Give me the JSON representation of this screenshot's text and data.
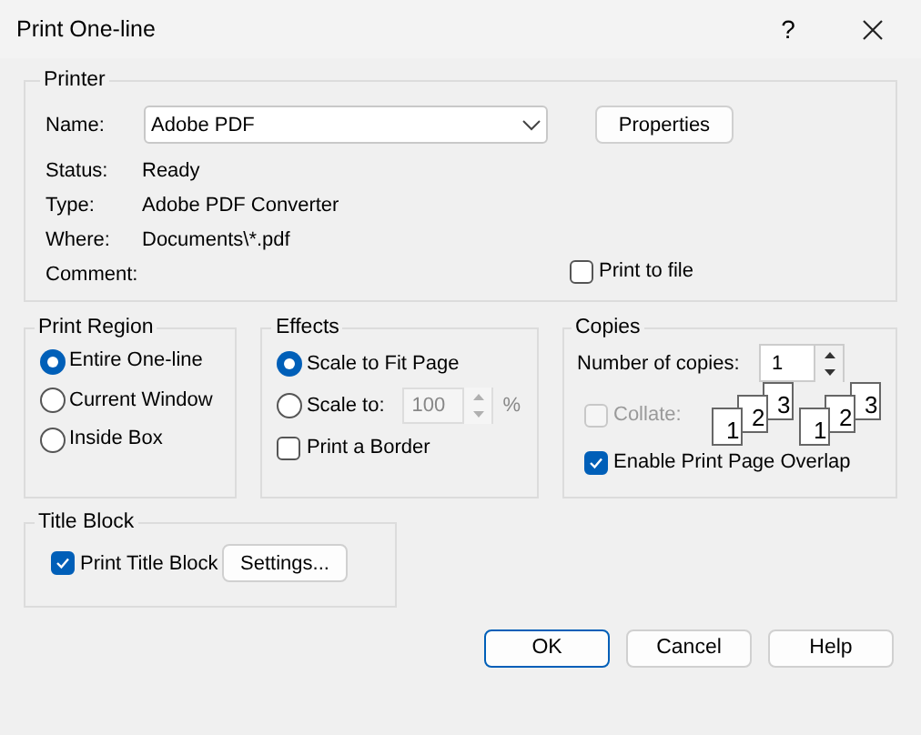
{
  "window": {
    "title": "Print One-line",
    "help_glyph": "?"
  },
  "printer": {
    "title": "Printer",
    "name_label": "Name:",
    "name_value": "Adobe PDF",
    "properties_button": "Properties",
    "info": [
      {
        "label": "Status:",
        "value": "Ready"
      },
      {
        "label": "Type:",
        "value": "Adobe PDF Converter"
      },
      {
        "label": "Where:",
        "value": "Documents\\*.pdf"
      },
      {
        "label": "Comment:"
      }
    ],
    "print_to_file": {
      "label": "Print to file",
      "checked": false
    }
  },
  "print_region": {
    "title": "Print Region",
    "options": [
      {
        "label": "Entire One-line",
        "selected": true
      },
      {
        "label": "Current Window",
        "selected": false
      },
      {
        "label": "Inside Box",
        "selected": false
      }
    ]
  },
  "effects": {
    "title": "Effects",
    "options": [
      {
        "kind": "radio",
        "label": "Scale to Fit Page",
        "selected": true
      },
      {
        "kind": "scale",
        "label": "Scale to:",
        "selected": false,
        "value": "100",
        "unit": "%",
        "disabled": true
      }
    ],
    "print_border": {
      "label": "Print a Border",
      "checked": false
    }
  },
  "copies": {
    "title": "Copies",
    "count_label": "Number of copies:",
    "count": "1",
    "collate": {
      "label": "Collate:",
      "checked": false,
      "disabled": true,
      "sets": [
        [
          "1",
          "2",
          "3"
        ],
        [
          "1",
          "2",
          "3"
        ]
      ]
    },
    "overlap": {
      "label": "Enable Print Page Overlap",
      "checked": true
    }
  },
  "title_block": {
    "title": "Title Block",
    "print": {
      "label": "Print Title Block",
      "checked": true
    },
    "settings_button": "Settings..."
  },
  "buttons": [
    {
      "label": "OK",
      "default": true
    },
    {
      "label": "Cancel",
      "default": false
    },
    {
      "label": "Help",
      "default": false
    }
  ]
}
